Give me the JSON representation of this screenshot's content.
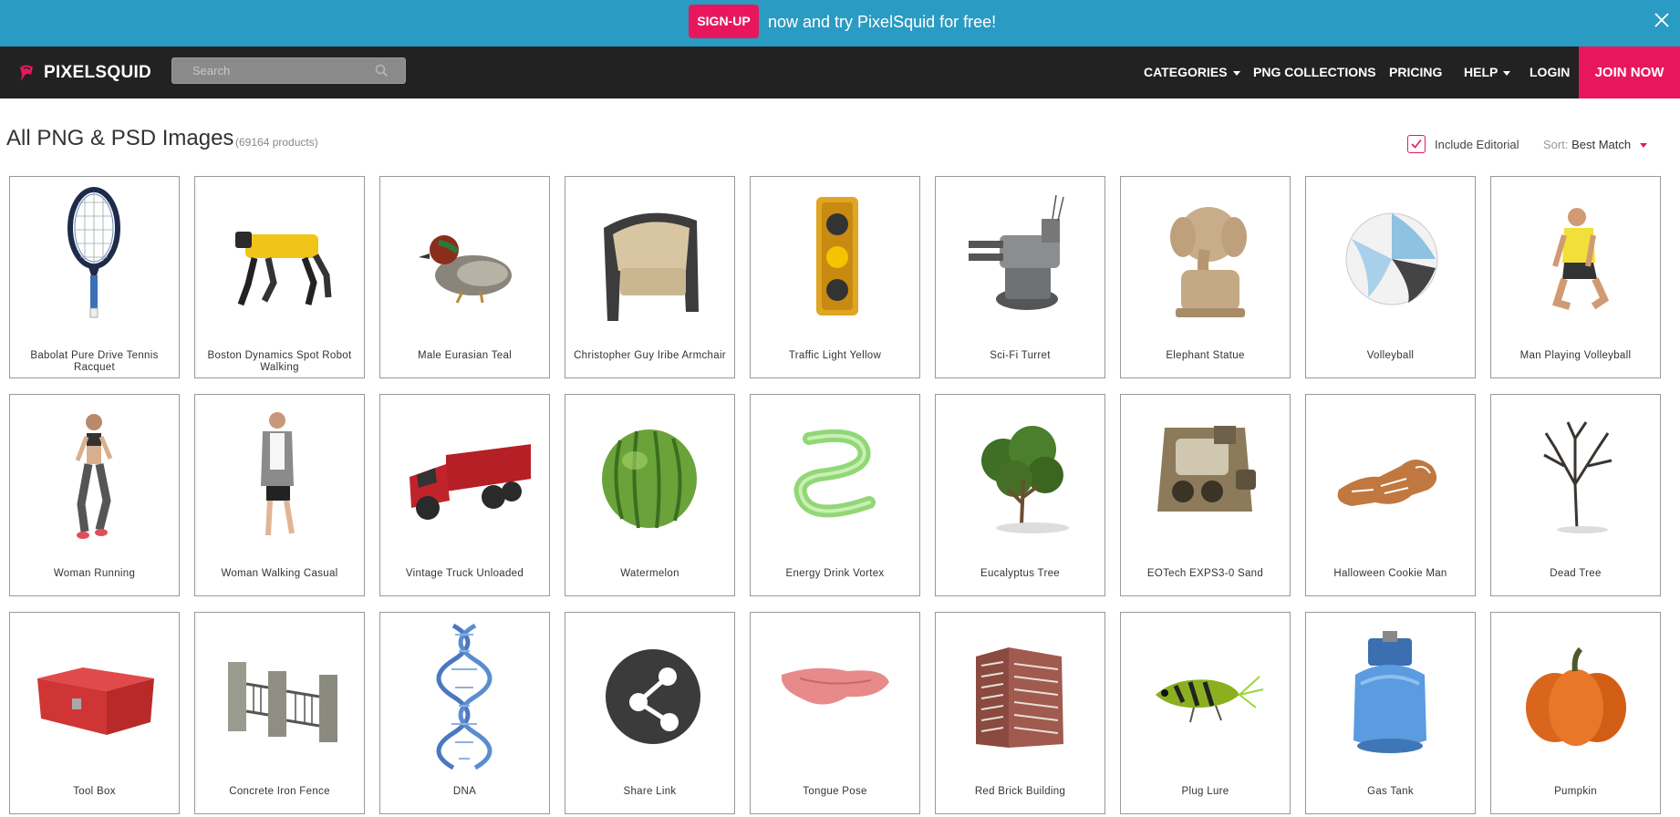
{
  "banner": {
    "signup_label": "SIGN-UP",
    "promo_text": "now and try PixelSquid for free!",
    "close_icon": "close-icon",
    "bg_color": "#2a9bc2",
    "accent_color": "#e8175d"
  },
  "nav": {
    "logo_text": "PIXELSQUID",
    "search_placeholder": "Search",
    "menu": {
      "categories": "CATEGORIES",
      "png_collections": "PNG COLLECTIONS",
      "pricing": "PRICING",
      "help": "HELP",
      "login": "LOGIN",
      "join_now": "JOIN NOW"
    }
  },
  "header": {
    "title": "All PNG & PSD Images",
    "count": "(69164 products)",
    "include_editorial_label": "Include Editorial",
    "include_editorial_checked": true,
    "sort_label": "Sort:",
    "sort_value": "Best Match"
  },
  "products": [
    {
      "name": "Babolat Pure Drive Tennis Racquet",
      "icon": "tennis-racquet-icon"
    },
    {
      "name": "Boston Dynamics Spot Robot Walking",
      "icon": "robot-dog-icon"
    },
    {
      "name": "Male Eurasian Teal",
      "icon": "duck-icon"
    },
    {
      "name": "Christopher Guy Iribe Armchair",
      "icon": "armchair-icon"
    },
    {
      "name": "Traffic Light Yellow",
      "icon": "traffic-light-icon"
    },
    {
      "name": "Sci-Fi Turret",
      "icon": "turret-icon"
    },
    {
      "name": "Elephant Statue",
      "icon": "elephant-statue-icon"
    },
    {
      "name": "Volleyball",
      "icon": "volleyball-icon"
    },
    {
      "name": "Man Playing Volleyball",
      "icon": "man-volleyball-icon"
    },
    {
      "name": "Woman Running",
      "icon": "woman-running-icon"
    },
    {
      "name": "Woman Walking Casual",
      "icon": "woman-walking-icon"
    },
    {
      "name": "Vintage Truck Unloaded",
      "icon": "truck-icon"
    },
    {
      "name": "Watermelon",
      "icon": "watermelon-icon"
    },
    {
      "name": "Energy Drink Vortex",
      "icon": "vortex-icon"
    },
    {
      "name": "Eucalyptus Tree",
      "icon": "tree-icon"
    },
    {
      "name": "EOTech EXPS3-0 Sand",
      "icon": "sight-icon"
    },
    {
      "name": "Halloween Cookie Man",
      "icon": "cookie-icon"
    },
    {
      "name": "Dead Tree",
      "icon": "dead-tree-icon"
    },
    {
      "name": "Tool Box",
      "icon": "toolbox-icon"
    },
    {
      "name": "Concrete Iron Fence",
      "icon": "fence-icon"
    },
    {
      "name": "DNA",
      "icon": "dna-icon"
    },
    {
      "name": "Share Link",
      "icon": "share-link-icon"
    },
    {
      "name": "Tongue Pose",
      "icon": "tongue-icon"
    },
    {
      "name": "Red Brick Building",
      "icon": "building-icon"
    },
    {
      "name": "Plug Lure",
      "icon": "fishing-lure-icon"
    },
    {
      "name": "Gas Tank",
      "icon": "gas-tank-icon"
    },
    {
      "name": "Pumpkin",
      "icon": "pumpkin-icon"
    }
  ]
}
